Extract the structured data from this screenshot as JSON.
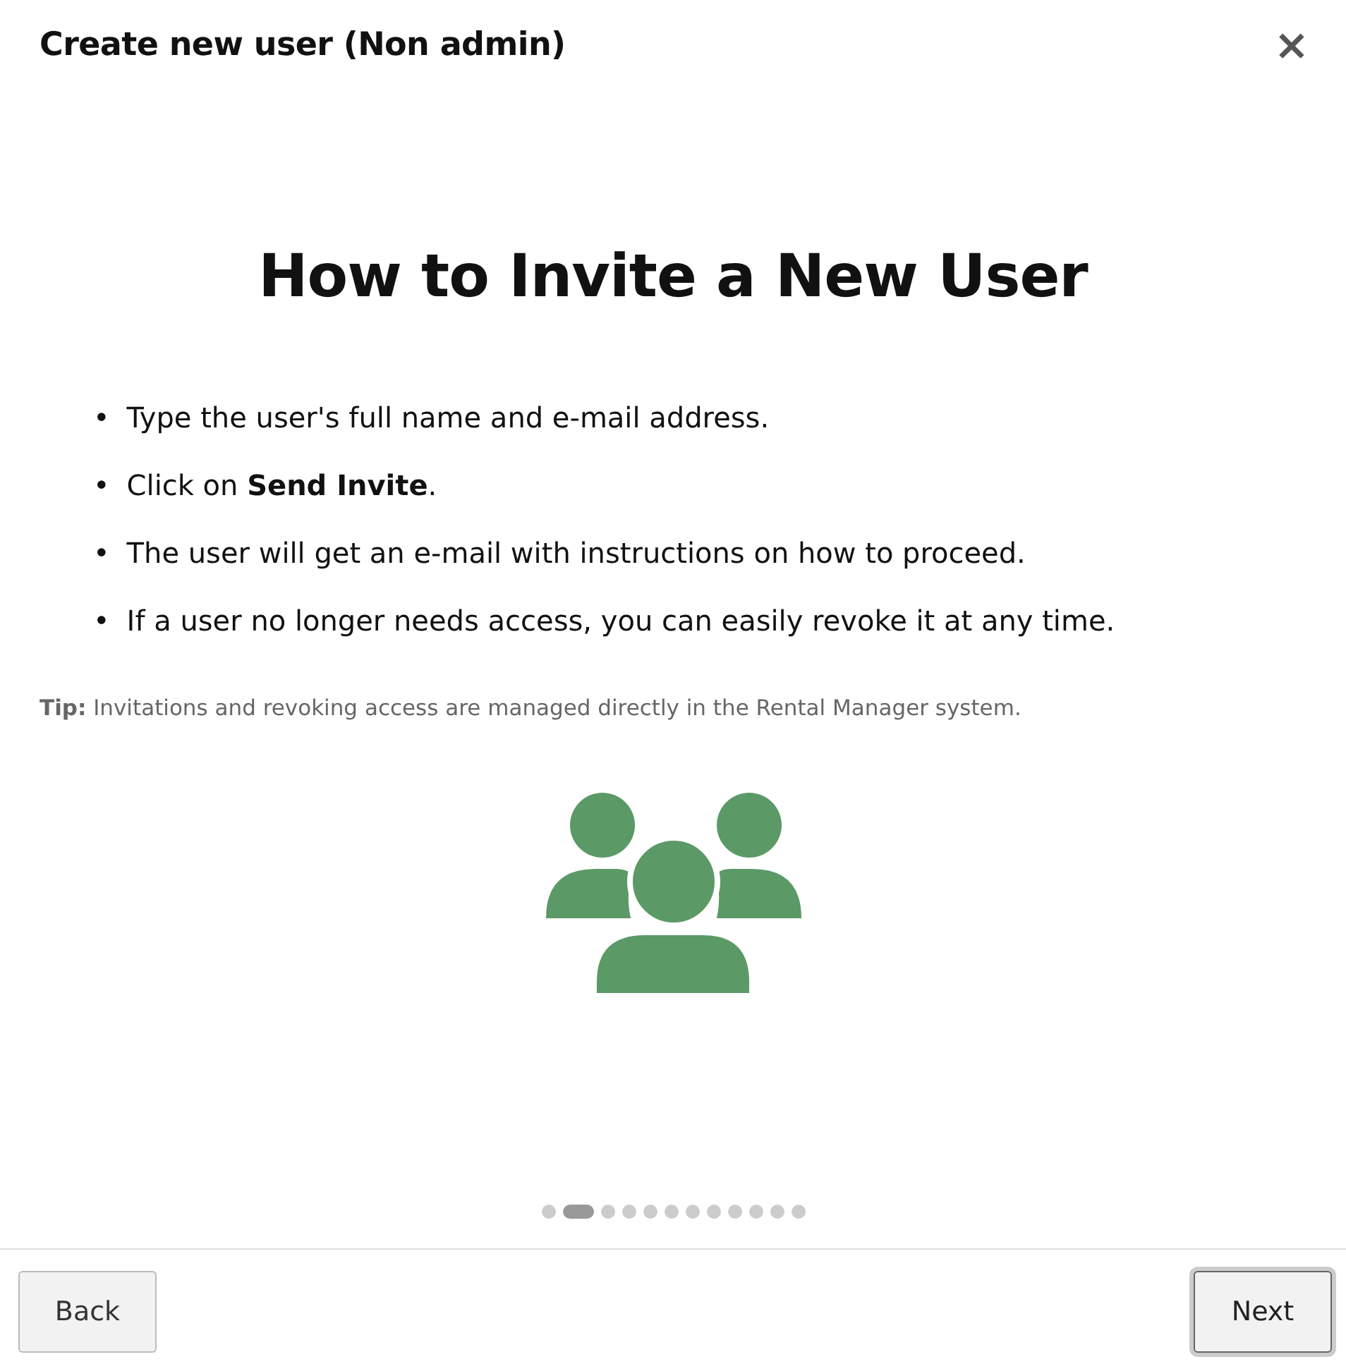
{
  "dialog": {
    "title": "Create new user (Non admin)",
    "close": "×"
  },
  "heading": "How to Invite a New User",
  "steps": [
    {
      "bullet": "•",
      "text": "Type the user's full name and e-mail address."
    },
    {
      "bullet": "•",
      "text": "Click on **Send Invite**."
    },
    {
      "bullet": "•",
      "text": "The user will get an e-mail with instructions on how to proceed."
    },
    {
      "bullet": "•",
      "text": "If a user no longer needs access, you can easily revoke it at any time."
    }
  ],
  "tip": {
    "label": "Tip:",
    "text": "Invitations and revoking access are managed directly in the Rental Manager system."
  },
  "pager": [
    {
      "selected": false
    },
    {
      "selected": true
    },
    {
      "selected": false
    },
    {
      "selected": false
    },
    {
      "selected": false
    },
    {
      "selected": false
    },
    {
      "selected": false
    },
    {
      "selected": false
    },
    {
      "selected": false
    },
    {
      "selected": false
    },
    {
      "selected": false
    },
    {
      "selected": false
    }
  ],
  "buttons": [
    {
      "label": "Back",
      "focused": false
    },
    {
      "label": "Next",
      "focused": true
    }
  ]
}
